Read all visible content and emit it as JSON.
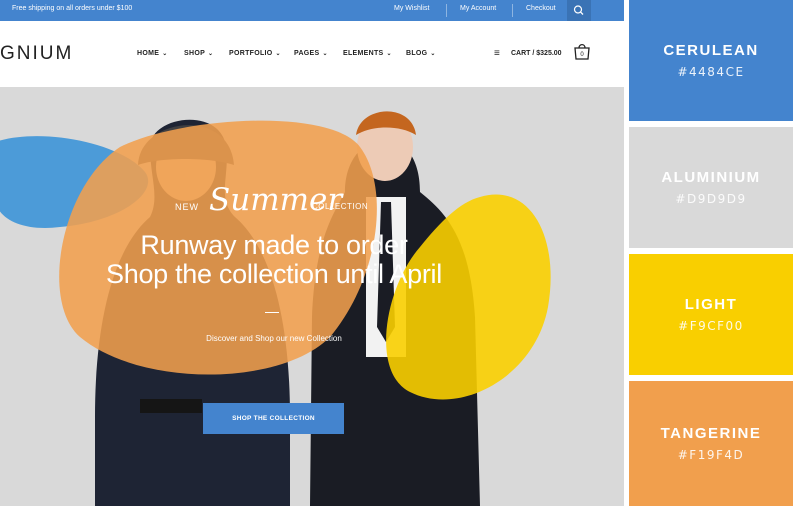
{
  "topbar": {
    "promo": "Free shipping on all orders under $100",
    "wishlist": "My Wishlist",
    "account": "My Account",
    "checkout": "Checkout"
  },
  "header": {
    "logo": "GNIUM",
    "nav": [
      {
        "label": "HOME"
      },
      {
        "label": "SHOP"
      },
      {
        "label": "PORTFOLIO"
      },
      {
        "label": "PAGES"
      },
      {
        "label": "ELEMENTS"
      },
      {
        "label": "BLOG"
      }
    ],
    "cart": "CART / $325.00"
  },
  "hero": {
    "kicker_new": "NEW",
    "kicker_script": "Summer",
    "kicker_collection": "COLLECTION",
    "headline_1": "Runway made to order",
    "headline_2": "Shop the collection until April",
    "subtext": "Discover and Shop our new Collection",
    "cta": "SHOP THE COLLECTION"
  },
  "palette": [
    {
      "name": "CERULEAN",
      "hex": "#4484CE"
    },
    {
      "name": "ALUMINIUM",
      "hex": "#D9D9D9"
    },
    {
      "name": "LIGHT",
      "hex": "#F9CF00"
    },
    {
      "name": "TANGERINE",
      "hex": "#F19F4D"
    }
  ],
  "colors": {
    "brand": "#4484CE",
    "hero_bg": "#D9D9D9",
    "yellow": "#F9CF00",
    "orange": "#F19F4D"
  }
}
